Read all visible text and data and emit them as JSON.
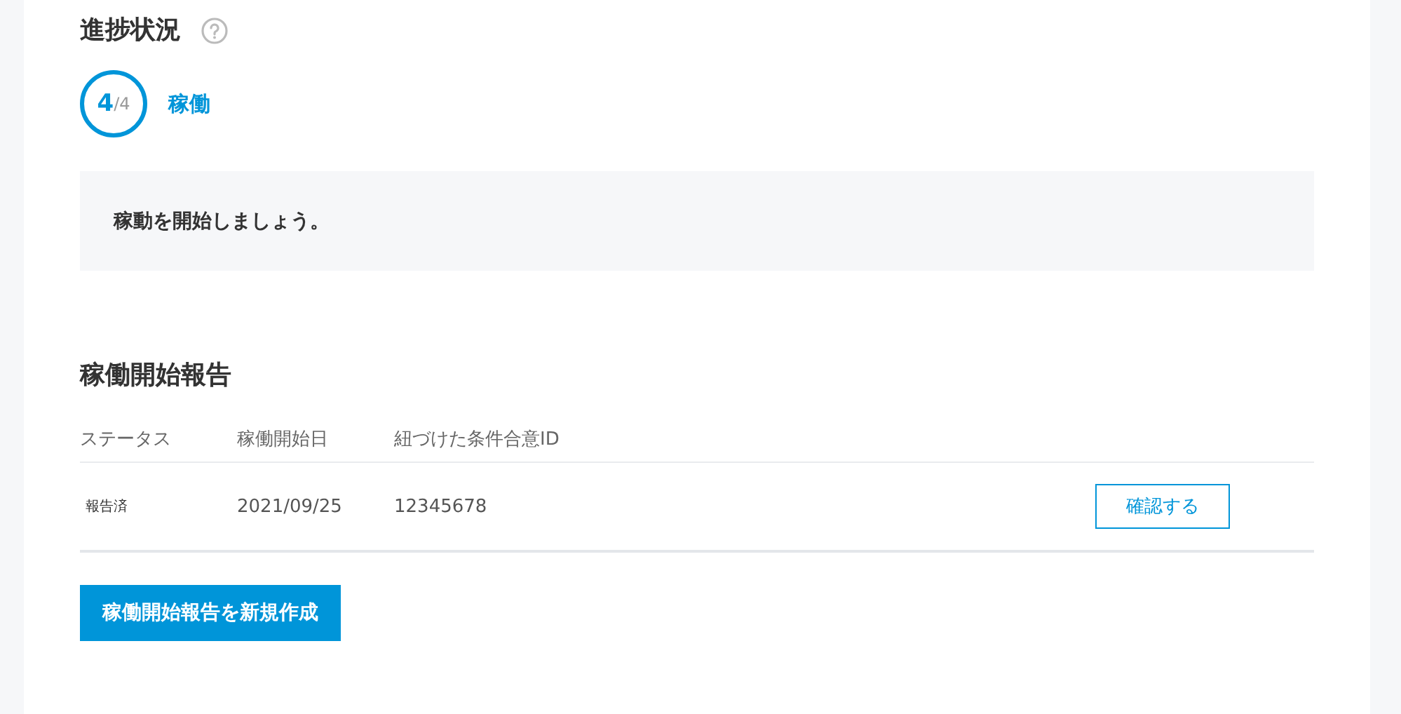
{
  "progress": {
    "title": "進捗状況",
    "step_current": "4",
    "step_total": "/4",
    "step_label": "稼働",
    "message": "稼動を開始しましょう。"
  },
  "report": {
    "title": "稼働開始報告",
    "columns": [
      "ステータス",
      "稼働開始日",
      "紐づけた条件合意ID"
    ],
    "rows": [
      {
        "status": "報告済",
        "start_date": "2021/09/25",
        "agreement_id": "12345678",
        "action": "確認する"
      }
    ],
    "create_button": "稼働開始報告を新規作成"
  }
}
